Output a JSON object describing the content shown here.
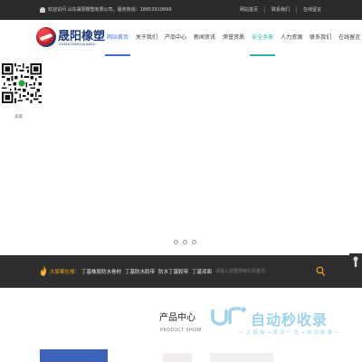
{
  "topbar": {
    "welcome": "欢迎访问 山东晟阳橡塑有限公司，服务热线：18853919999",
    "links": [
      "网站首页",
      "联系我们",
      "在线留言"
    ]
  },
  "logo": {
    "name": "晟阳橡塑",
    "en": "SHENGYANGXIANSU"
  },
  "nav": {
    "items": [
      {
        "label": "网站首页",
        "state": "active"
      },
      {
        "label": "关于我们",
        "state": "normal"
      },
      {
        "label": "产品中心",
        "state": "normal"
      },
      {
        "label": "新闻资讯",
        "state": "normal"
      },
      {
        "label": "荣誉资质",
        "state": "normal"
      },
      {
        "label": "安全手册",
        "state": "highlight"
      },
      {
        "label": "人力资源",
        "state": "normal"
      },
      {
        "label": "联系我们",
        "state": "normal"
      },
      {
        "label": "在线留言",
        "state": "normal"
      }
    ]
  },
  "banner": {
    "qr_label": "美观",
    "slider_dots": 3
  },
  "search": {
    "hot_label": "大家都在搜：",
    "keywords": [
      "丁基橡胶防水卷材",
      "丁基防水胶带",
      "防水丁基胶带",
      "丁基双面"
    ],
    "placeholder": "请输入您要搜索的关键词",
    "icon": "search-icon"
  },
  "product": {
    "title": "产品中心",
    "subtitle": "PRODUCT SHOW"
  },
  "watermark": {
    "brand": "自动秒收录",
    "tagline": "— 上 链 接 → 来 访 一 次 → 自 动 收 录 —"
  },
  "colors": {
    "accent": "#3c6fd1",
    "highlight": "#2bb3b1",
    "dark_bar": "#2e2e2e",
    "top_bar": "#2b2b2b",
    "hot": "#f0a020",
    "brand_blue": "#1f3a7a",
    "brand_red": "#d32f2f"
  }
}
